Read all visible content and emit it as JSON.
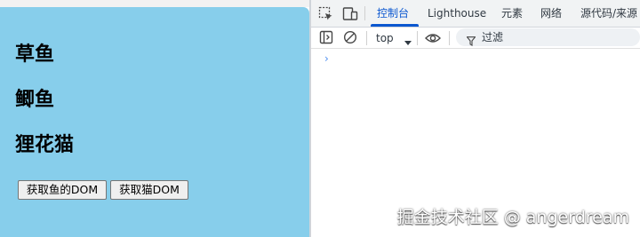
{
  "page": {
    "headings": [
      "草鱼",
      "鲫鱼",
      "狸花猫"
    ],
    "buttons": {
      "get_fish": "获取鱼的DOM",
      "get_cat": "获取猫DOM"
    }
  },
  "devtools": {
    "tabs": [
      "控制台",
      "Lighthouse",
      "元素",
      "网络",
      "源代码/来源"
    ],
    "active_tab": "控制台",
    "context": "top",
    "filter_label": "过滤",
    "prompt_symbol": "›",
    "icons": [
      "inspect-element-icon",
      "device-toolbar-icon",
      "sidebar-toggle-icon",
      "clear-console-icon",
      "dropdown-caret-icon",
      "eye-icon",
      "filter-icon"
    ]
  },
  "colors": {
    "page_bg": "#87ceeb",
    "active_tab": "#0b57d0"
  },
  "watermark": "掘金技术社区 @ angerdream"
}
